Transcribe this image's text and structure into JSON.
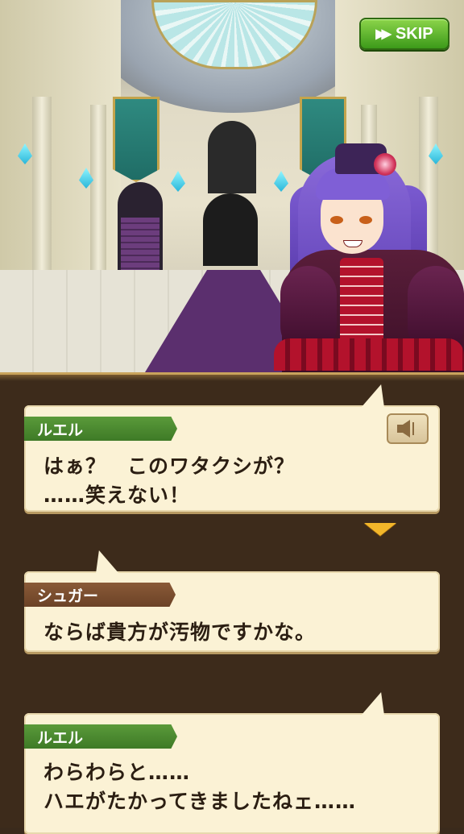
{
  "header": {
    "skip_label": "SKIP",
    "skip_icon": "fast-forward-icon"
  },
  "dialogue": [
    {
      "speaker": "ルエル",
      "speaker_color": "#4e8c30",
      "lines": [
        "はぁ？　このワタクシが？",
        "……笑えない！"
      ],
      "has_voice_button": true,
      "voice_icon": "speaker-icon"
    },
    {
      "speaker": "シュガー",
      "speaker_color": "#7a4c2e",
      "lines": [
        "ならば貴方が汚物ですかな。"
      ]
    },
    {
      "speaker": "ルエル",
      "speaker_color": "#4e8c30",
      "lines": [
        "わらわらと……",
        "ハエがたかってきましたねェ……"
      ]
    }
  ],
  "indicators": {
    "next_icon": "next-page-triangle-icon",
    "next_color": "#f2b62a"
  }
}
